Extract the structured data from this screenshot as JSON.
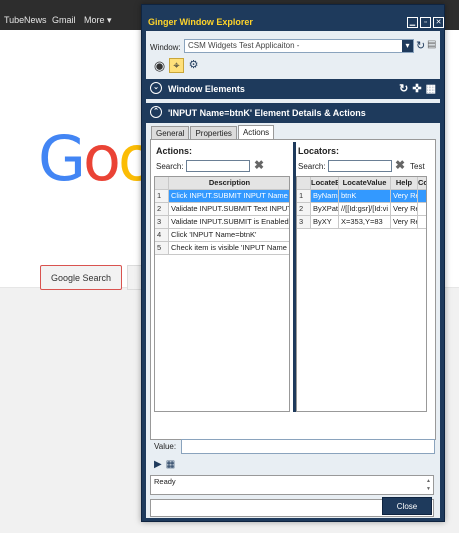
{
  "browser": {
    "links": [
      "Tube",
      "News",
      "Gmail",
      "More"
    ],
    "more_caret": "▾",
    "logo_letters": [
      {
        "ch": "G",
        "color": "#4285f4"
      },
      {
        "ch": "o",
        "color": "#ea4335"
      },
      {
        "ch": "o",
        "color": "#fbbc05"
      }
    ],
    "search_button": "Google Search"
  },
  "explorer": {
    "title": "Ginger Window Explorer",
    "window_controls": [
      "▫",
      "◻",
      "✕"
    ],
    "window_label": "Window:",
    "window_value": "CSM Widgets Test Applicaiton -",
    "window_elements_title": "Window Elements",
    "element_details_title": "'INPUT Name=btnK' Element Details & Actions",
    "tabs": [
      {
        "label": "General",
        "active": false
      },
      {
        "label": "Properties",
        "active": false
      },
      {
        "label": "Actions",
        "active": true
      }
    ],
    "actions": {
      "title": "Actions:",
      "search_label": "Search:",
      "columns": [
        "",
        "Description"
      ],
      "rows": [
        {
          "num": "1",
          "desc": "Click INPUT.SUBMIT INPUT Name",
          "selected": true
        },
        {
          "num": "2",
          "desc": "Validate INPUT.SUBMIT Text INPUT",
          "selected": false
        },
        {
          "num": "3",
          "desc": "Validate INPUT.SUBMIT is Enabled",
          "selected": false
        },
        {
          "num": "4",
          "desc": "Click 'INPUT Name=btnK'",
          "selected": false
        },
        {
          "num": "5",
          "desc": "Check item is visible 'INPUT Name",
          "selected": false
        }
      ]
    },
    "locators": {
      "title": "Locators:",
      "search_label": "Search:",
      "test_label": "Test",
      "columns": [
        "",
        "LocateB",
        "LocateValue",
        "Help",
        "Cou"
      ],
      "rows": [
        {
          "num": "1",
          "by": "ByNam",
          "value": "btnK",
          "help": "Very Re",
          "selected": true
        },
        {
          "num": "2",
          "by": "ByXPat",
          "value": "//[[Id:gsr]/[Id:vi",
          "help": "Very Re",
          "selected": false
        },
        {
          "num": "3",
          "by": "ByXY",
          "value": "X=353,Y=83",
          "help": "Very Re",
          "selected": false
        }
      ]
    },
    "value_label": "Value:",
    "status_text": "Ready",
    "close_label": "Close"
  }
}
